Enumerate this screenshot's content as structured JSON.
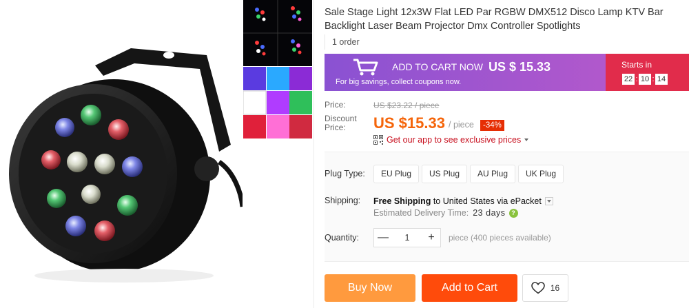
{
  "product": {
    "title": "Sale Stage Light 12x3W Flat LED Par RGBW DMX512 Disco Lamp KTV Bar Backlight Laser Beam Projector Dmx Controller Spotlights",
    "orders": "1 order"
  },
  "promo": {
    "add_to_cart": "ADD TO CART NOW",
    "price": "US $ 15.33",
    "subtext": "For big savings, collect coupons now.",
    "starts_in": "Starts in",
    "timer": {
      "hours": "22",
      "minutes": "10",
      "seconds": "14"
    },
    "colors": {
      "left": "#9a55d0",
      "right": "#e12c4b"
    }
  },
  "pricing": {
    "price_label": "Price:",
    "original_price": "US $23.22 / piece",
    "discount_label": "Discount Price:",
    "discount_price": "US $15.33",
    "unit": "/ piece",
    "discount_badge": "-34%",
    "app_link": "Get our app to see exclusive prices"
  },
  "options": {
    "plug_label": "Plug Type:",
    "plugs": [
      "EU Plug",
      "US Plug",
      "AU Plug",
      "UK Plug"
    ]
  },
  "shipping": {
    "label": "Shipping:",
    "free_text": "Free Shipping",
    "to_text": "to United States via ePacket",
    "est_label": "Estimated Delivery Time:",
    "est_days": "23 days"
  },
  "quantity": {
    "label": "Quantity:",
    "value": "1",
    "minus": "—",
    "plus": "+",
    "availability": "piece (400 pieces available)"
  },
  "actions": {
    "buy_now": "Buy Now",
    "add_to_cart": "Add to Cart",
    "wishlist_count": "16",
    "colors": {
      "buy_now": "#ff9a3e",
      "add_to_cart": "#ff4b0b"
    }
  },
  "icons": [
    "cart-icon",
    "qr-code-icon",
    "chevron-down-icon",
    "question-icon",
    "heart-icon"
  ]
}
